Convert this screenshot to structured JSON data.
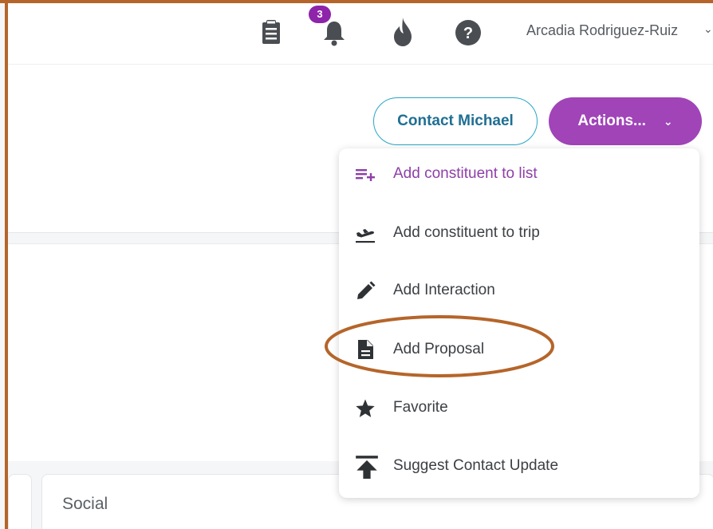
{
  "topbar": {
    "icons": [
      "clipboard-icon",
      "bell-icon",
      "flame-icon",
      "help-icon"
    ],
    "notification_count": "3",
    "user_name": "Arcadia Rodriguez-Ruiz",
    "user_chevron": "⌄"
  },
  "header": {
    "contact_button": "Contact Michael",
    "actions_button": "Actions...",
    "actions_chevron": "⌄"
  },
  "actions_menu": {
    "items": [
      {
        "label": "Add constituent to list",
        "icon": "playlist-add-icon"
      },
      {
        "label": "Add constituent to trip",
        "icon": "airplane-takeoff-icon"
      },
      {
        "label": "Add Interaction",
        "icon": "pencil-icon"
      },
      {
        "label": "Add Proposal",
        "icon": "document-icon"
      },
      {
        "label": "Favorite",
        "icon": "star-icon"
      },
      {
        "label": "Suggest Contact Update",
        "icon": "upload-icon"
      }
    ]
  },
  "cards": {
    "social_title": "Social"
  },
  "colors": {
    "accent_purple": "#a044b8",
    "contact_border": "#2aa6c8",
    "annotation": "#b5652a"
  }
}
